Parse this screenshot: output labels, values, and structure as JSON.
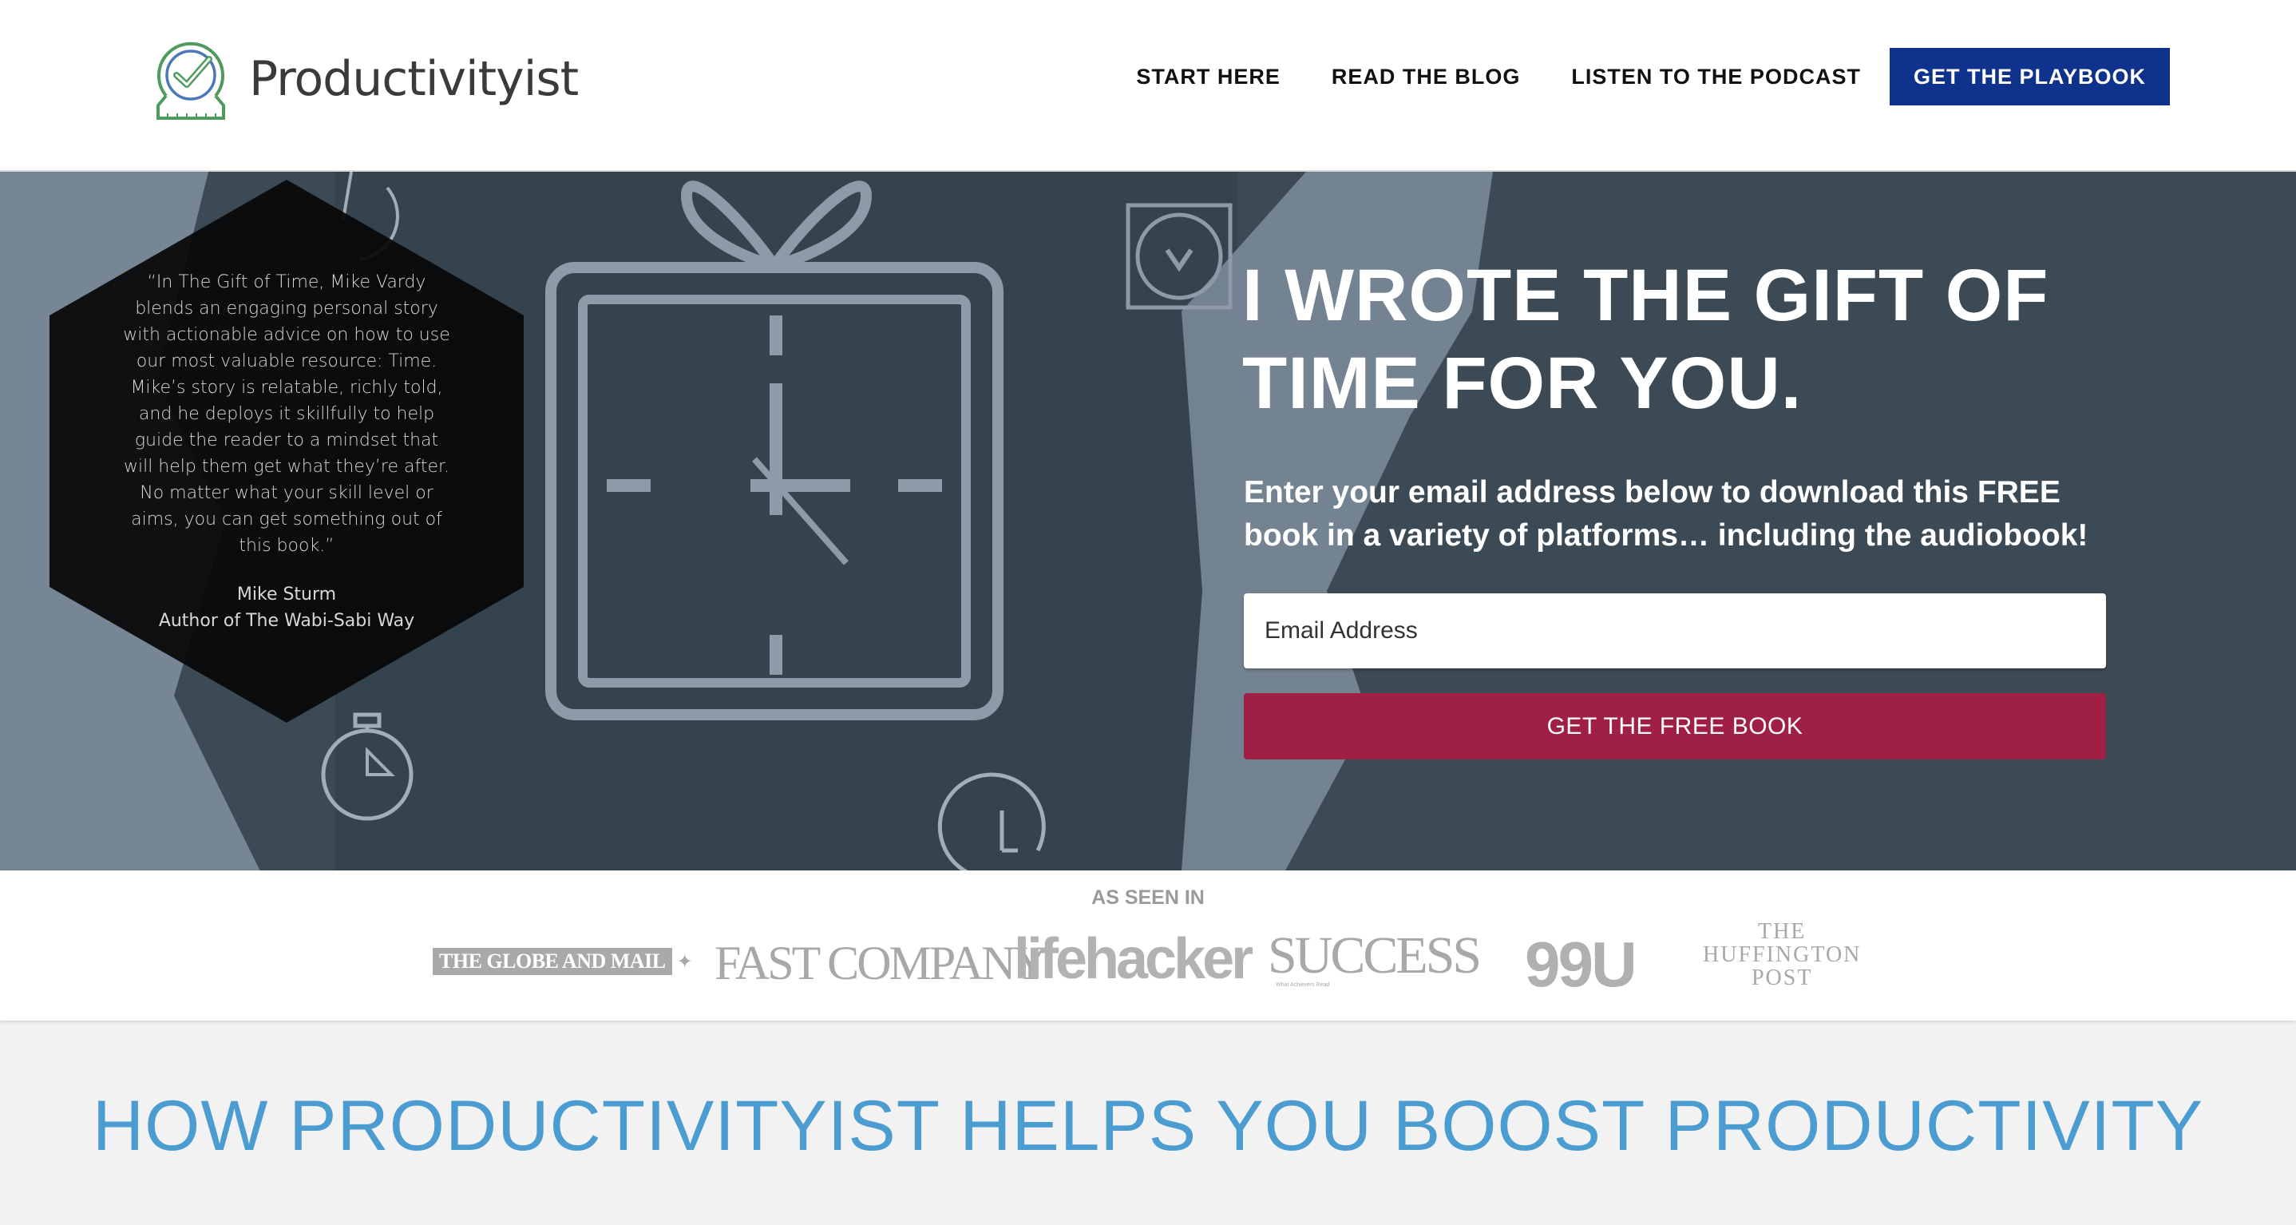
{
  "header": {
    "logo_text": "Productivityist",
    "logo_icon": "checkmark-clock-icon",
    "nav": [
      {
        "label": "START HERE"
      },
      {
        "label": "READ THE BLOG"
      },
      {
        "label": "LISTEN TO THE PODCAST"
      },
      {
        "label": "GET THE PLAYBOOK"
      }
    ],
    "cta_color": "#0f338c"
  },
  "hero": {
    "testimonial": {
      "quote": "“In The Gift of Time, Mike Vardy blends an engaging personal story with actionable advice on how to use our most valuable resource: Time. Mike’s story is relatable, richly told, and he deploys it skillfully to help guide the reader to a mindset that will help them get what they’re after. No matter what your skill level or aims, you can get something out of this book.”",
      "author_name": "Mike Sturm",
      "author_title": "Author of The Wabi-Sabi Way"
    },
    "headline": "I WROTE THE GIFT OF TIME FOR YOU.",
    "subtext": "Enter your email address below to download this FREE book in a variety of platforms… including the audiobook!",
    "email": {
      "value": "",
      "placeholder": "Email Address"
    },
    "submit_label": "GET THE FREE BOOK",
    "submit_color": "#a01f45",
    "decor_icons": [
      "gift-clock-icon",
      "wall-clock-icon",
      "stopwatch-icon",
      "timer-icon"
    ]
  },
  "press": {
    "label": "AS SEEN IN",
    "logos": {
      "globe": "THE GLOBE AND MAIL",
      "fast": "FAST COMPANY",
      "life": "lifehacker",
      "success": "SUCCESS",
      "success_tag": "What Achievers Read",
      "nine": "99U",
      "huff_1": "THE",
      "huff_2": "HUFFINGTON",
      "huff_3": "POST"
    }
  },
  "section": {
    "title": "HOW PRODUCTIVITYIST HELPS YOU BOOST PRODUCTIVITY",
    "title_color": "#4b9cd0"
  }
}
